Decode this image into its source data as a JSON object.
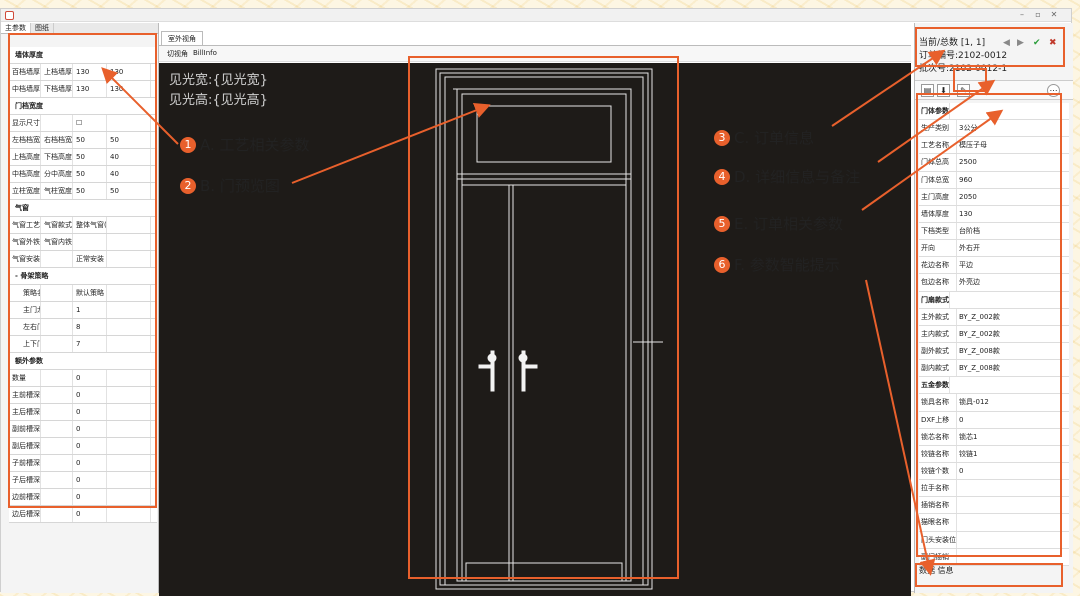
{
  "window": {
    "controls": [
      "–",
      "▫",
      "✕"
    ]
  },
  "left": {
    "tabs": [
      "主参数",
      "图纸"
    ],
    "rows": [
      {
        "type": "sec",
        "cells": [
          "墙体厚度"
        ]
      },
      {
        "cells": [
          "百档墙厚",
          "上档墙厚",
          "130",
          "130"
        ]
      },
      {
        "cells": [
          "中档墙厚",
          "下档墙厚",
          "130",
          "130"
        ]
      },
      {
        "type": "sec",
        "cells": [
          "门档宽度"
        ]
      },
      {
        "cells": [
          "显示尺寸",
          "",
          "☐",
          ""
        ]
      },
      {
        "cells": [
          "左档档宽",
          "右档档宽",
          "50",
          "50"
        ]
      },
      {
        "cells": [
          "上档高度",
          "下档高度",
          "50",
          "40"
        ]
      },
      {
        "cells": [
          "中档高度",
          "分中高度",
          "50",
          "40"
        ]
      },
      {
        "cells": [
          "立柱宽度",
          "气柱宽度",
          "50",
          "50"
        ]
      },
      {
        "type": "sec",
        "cells": [
          "气窗"
        ]
      },
      {
        "cells": [
          "气窗工艺",
          "气窗款式",
          "整体气窗(",
          ""
        ]
      },
      {
        "cells": [
          "气窗外铁",
          "气窗内铁",
          "",
          ""
        ]
      },
      {
        "cells": [
          "气窗安装方式",
          "",
          "正常安装",
          ""
        ],
        "wide": true
      },
      {
        "type": "sec",
        "cells": [
          "- 骨架策略"
        ]
      },
      {
        "cells": [
          "策略名称",
          "",
          "默认策略",
          ""
        ],
        "sub": true
      },
      {
        "cells": [
          "主门龙骨",
          "",
          "1",
          ""
        ],
        "sub": true
      },
      {
        "cells": [
          "左右门框",
          "",
          "8",
          ""
        ],
        "sub": true
      },
      {
        "cells": [
          "上下门框",
          "",
          "7",
          ""
        ],
        "sub": true
      },
      {
        "type": "sec",
        "cells": [
          "额外参数"
        ]
      },
      {
        "cells": [
          "数量",
          "",
          "0",
          ""
        ]
      },
      {
        "cells": [
          "主前槽深",
          "",
          "0",
          ""
        ]
      },
      {
        "cells": [
          "主后槽深",
          "",
          "0",
          ""
        ]
      },
      {
        "cells": [
          "副前槽深",
          "",
          "0",
          ""
        ]
      },
      {
        "cells": [
          "副后槽深",
          "",
          "0",
          ""
        ]
      },
      {
        "cells": [
          "子前槽深",
          "",
          "0",
          ""
        ]
      },
      {
        "cells": [
          "子后槽深",
          "",
          "0",
          ""
        ]
      },
      {
        "cells": [
          "边前槽深",
          "",
          "0",
          ""
        ]
      },
      {
        "cells": [
          "边后槽深",
          "",
          "0",
          ""
        ]
      }
    ]
  },
  "center": {
    "tab": "室外视角",
    "toolbar": [
      "切视角",
      "BillInfo"
    ],
    "view_width": "见光宽:{见光宽}",
    "view_height": "见光高:{见光高}"
  },
  "right": {
    "current_total": "当前/总数 [1, 1]",
    "order_no": "订单编号:2102-0012",
    "batch_no": "批次号:2102-0012-1",
    "nav_icons": [
      "◀",
      "▶",
      "✔",
      "✖"
    ],
    "tool_icons": [
      "▤",
      "⬇",
      "✎",
      "⋯"
    ],
    "rows": [
      {
        "type": "sec",
        "k": "门体参数"
      },
      {
        "k": "生产类别",
        "v": "3公分"
      },
      {
        "k": "工艺名称",
        "v": "模压子母"
      },
      {
        "k": "门体总高",
        "v": "2500"
      },
      {
        "k": "门体总宽",
        "v": "960"
      },
      {
        "k": "主门高度",
        "v": "2050"
      },
      {
        "k": "墙体厚度",
        "v": "130"
      },
      {
        "k": "下档类型",
        "v": "台阶档"
      },
      {
        "k": "开向",
        "v": "外右开"
      },
      {
        "k": "花边名称",
        "v": "平边"
      },
      {
        "k": "包边名称",
        "v": "外亮边"
      },
      {
        "type": "sec",
        "k": "门扇款式"
      },
      {
        "k": "主外款式",
        "v": "BY_Z_002款"
      },
      {
        "k": "主内款式",
        "v": "BY_Z_002款"
      },
      {
        "k": "副外款式",
        "v": "BY_Z_008款"
      },
      {
        "k": "副内款式",
        "v": "BY_Z_008款"
      },
      {
        "type": "sec",
        "k": "五金参数"
      },
      {
        "k": "锁具名称",
        "v": "锁具-012"
      },
      {
        "k": "DXF上移",
        "v": "0"
      },
      {
        "k": "锁芯名称",
        "v": "锁芯1"
      },
      {
        "k": "铰链名称",
        "v": "铰链1"
      },
      {
        "k": "铰链个数",
        "v": "0"
      },
      {
        "k": "拉手名称",
        "v": ""
      },
      {
        "k": "插销名称",
        "v": ""
      },
      {
        "k": "猫眼名称",
        "v": ""
      },
      {
        "k": "门头安装位置",
        "v": ""
      },
      {
        "k": "副门插销",
        "v": ""
      }
    ],
    "footer": "数据 信息"
  },
  "annotations": [
    {
      "num": "1",
      "label": "A. 工艺相关参数"
    },
    {
      "num": "2",
      "label": "B. 门预览图"
    },
    {
      "num": "3",
      "label": "C. 订单信息"
    },
    {
      "num": "4",
      "label": "D. 详细信息与备注"
    },
    {
      "num": "5",
      "label": "E. 订单相关参数"
    },
    {
      "num": "6",
      "label": "F. 参数智能提示"
    }
  ],
  "colors": {
    "accent": "#e8602c",
    "viewport": "#1e1b18",
    "line": "#e6e6e6"
  }
}
